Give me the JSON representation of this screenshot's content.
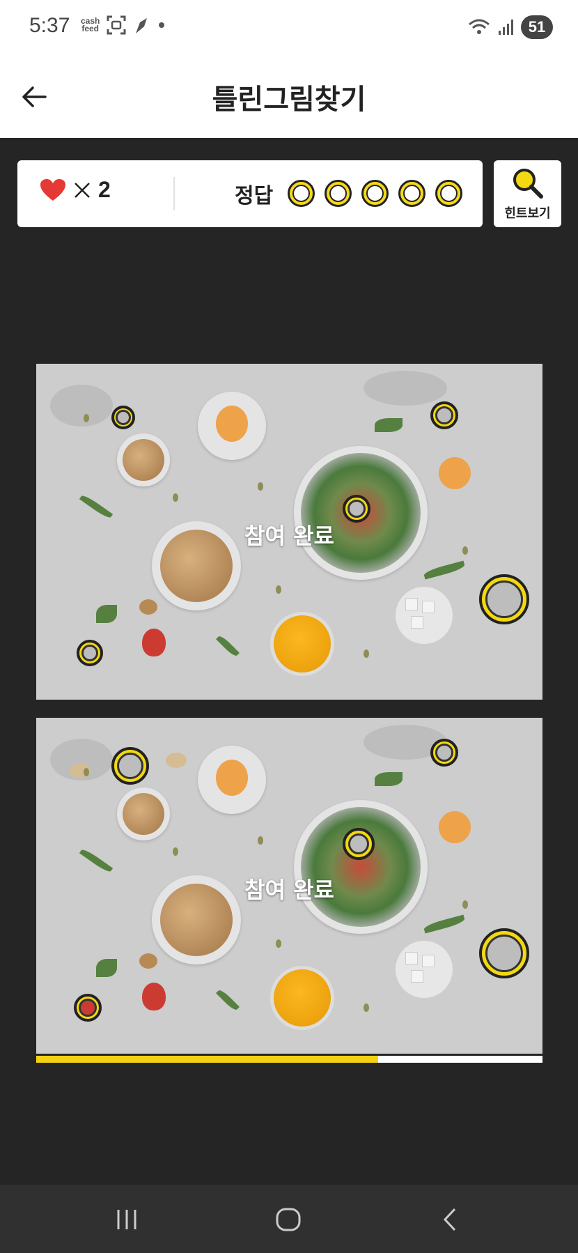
{
  "status_bar": {
    "time": "5:37",
    "cashfeed_line1": "cash",
    "cashfeed_line2": "feed",
    "battery": "51"
  },
  "header": {
    "title": "틀린그림찾기",
    "back_icon": "arrow-left-icon"
  },
  "game_info": {
    "lives_icon": "heart-icon",
    "lives_times": "×",
    "lives_count": "2",
    "answer_label": "정답",
    "answers_found": 5,
    "answers_total": 5
  },
  "hint_button": {
    "label": "힌트보기",
    "icon": "magnifier-icon"
  },
  "puzzle": {
    "overlay_text": "참여 완료",
    "progress_fraction": 0.675
  },
  "colors": {
    "accent": "#f3d812",
    "heart": "#e53935",
    "background": "#252525"
  },
  "nav_bar": {
    "recents_icon": "recents-icon",
    "home_icon": "home-icon",
    "back_icon": "back-chevron-icon"
  }
}
